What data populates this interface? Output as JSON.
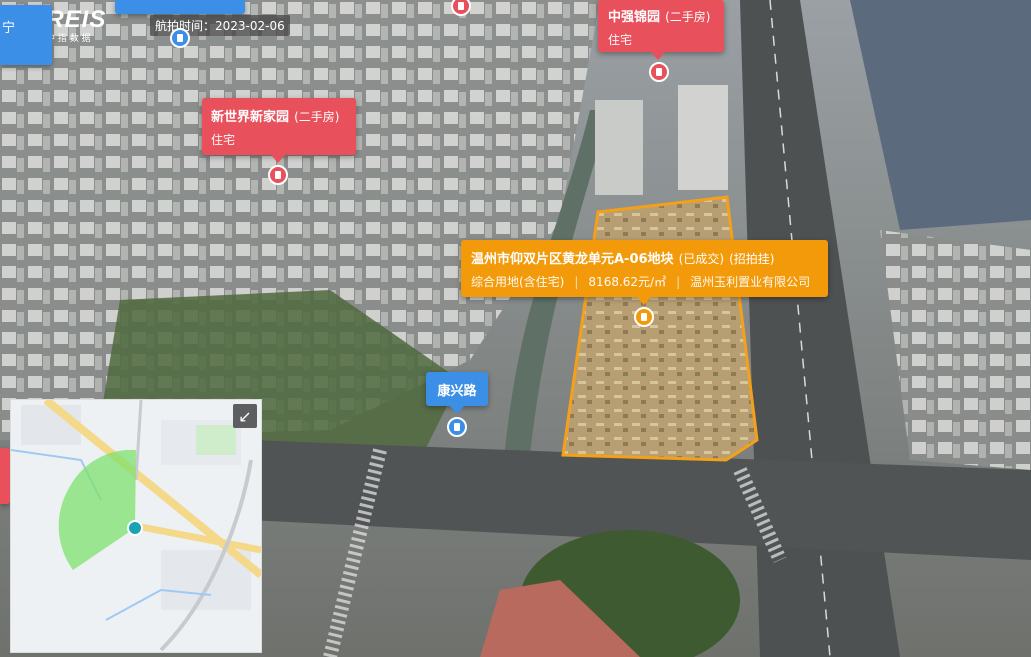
{
  "header": {
    "brand": "CREIS",
    "brand_sub": "中 指 数 据",
    "partial_left_text": "宁",
    "capture_time": "航拍时间：2023-02-06"
  },
  "labels": {
    "zhongqiang": {
      "name": "中强锦园",
      "tag": "(二手房)",
      "type": "住宅"
    },
    "xinshijie": {
      "name": "新世界新家园",
      "tag": "(二手房)",
      "type": "住宅"
    },
    "parcel": {
      "name": "温州市仰双片区黄龙单元A-06地块",
      "status": "(已成交)",
      "method": "(招拍挂)",
      "use": "综合用地(含住宅)",
      "price": "8168.62元/㎡",
      "buyer": "温州玉利置业有限公司"
    },
    "station": {
      "name": "康兴路"
    }
  },
  "colors": {
    "residential_label": "#e8505b",
    "parcel_label": "#f39a0b",
    "station_label": "#3b8fe6",
    "parcel_outline": "#f5a01a",
    "minimap_sector": "#7ee06d"
  },
  "icons": {
    "building_pin": "building-icon",
    "parcel_pin": "grid-icon",
    "bus_pin": "bus-icon",
    "expand_minimap": "collapse-arrow-icon",
    "minimap_marker": "camera-icon"
  }
}
